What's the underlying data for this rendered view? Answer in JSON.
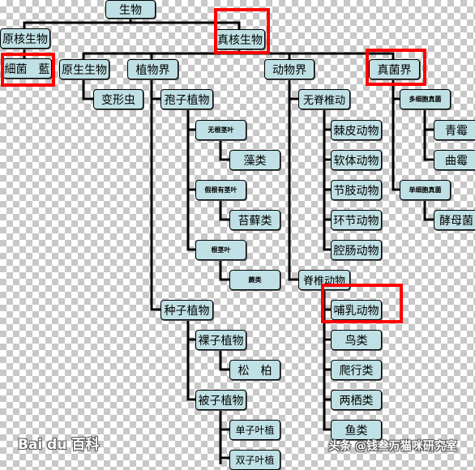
{
  "nodes": {
    "root": "生物",
    "prokaryote": "原核生物",
    "eukaryote": "真核生物",
    "bacteria": "細菌　藍",
    "protist": "原生生物",
    "plant": "植物界",
    "animal": "动物界",
    "fungi": "真菌界",
    "amoeba": "变形虫",
    "spore_plant": "孢子植物",
    "no_root": "无根茎叶",
    "algae": "藻类",
    "pseudo_root": "假根有茎叶",
    "moss": "苔藓类",
    "root_stem_leaf": "根茎叶",
    "fern": "蕨类",
    "seed_plant": "种子植物",
    "gymnosperm": "裸子植物",
    "pine": "松　柏",
    "angiosperm": "被子植物",
    "monocot": "单子叶植",
    "dicot": "双子叶植",
    "invertebrate": "无脊椎动",
    "echinoderm": "棘皮动物",
    "mollusk": "软体动物",
    "arthropod": "节肢动物",
    "annelid": "环节动物",
    "coelenterate": "腔肠动物",
    "vertebrate": "脊椎动物",
    "mammal": "哺乳动物",
    "bird": "鸟类",
    "reptile": "爬行类",
    "amphibian": "两栖类",
    "fish": "鱼类",
    "multicell_fungi": "多细胞真菌",
    "penicillium": "青霉",
    "aspergillus": "曲霉",
    "unicell_fungi": "单细胞真菌",
    "yeast": "酵母菌"
  },
  "watermarks": {
    "baidu": "Bai du 百科",
    "toutiao": "头条 @钱叁万猫咪研究室"
  },
  "colors": {
    "node_fill": "#bfe0e4",
    "highlight": "#ff0000",
    "line": "#000000"
  }
}
